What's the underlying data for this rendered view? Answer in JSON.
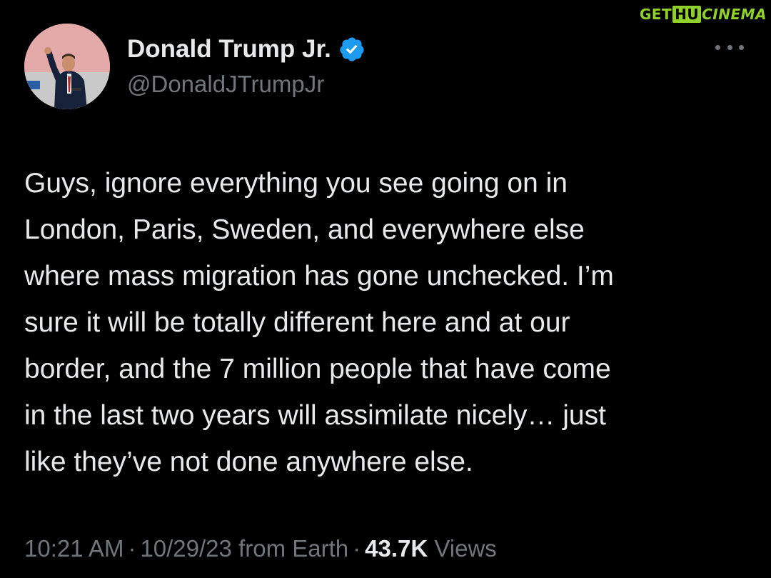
{
  "watermark": {
    "get": "GET",
    "hu": "HU",
    "cinema": "CINEMA"
  },
  "user": {
    "display_name": "Donald Trump Jr.",
    "handle": "@DonaldJTrumpJr",
    "verified": true,
    "verified_icon": "verified-badge-icon",
    "avatar_icon": "profile-photo"
  },
  "tweet": {
    "text": "Guys, ignore everything you see going on in\nLondon, Paris, Sweden, and everywhere else\nwhere mass migration has gone unchecked. I’m\nsure it will be totally different here and at our\nborder, and the 7 million people that have come\nin the last two years will assimilate nicely… just\nlike they’ve not done anywhere else.",
    "time": "10:21 AM",
    "date": "10/29/23 from Earth",
    "separator": "·",
    "views_count": "43.7K",
    "views_label": "Views"
  },
  "more_menu_icon": "more-horizontal-icon",
  "colors": {
    "background": "#000000",
    "primary_text": "#e7e9ea",
    "secondary_text": "#71767b",
    "verified_blue": "#1d9bf0",
    "watermark_green": "#8fd12a"
  }
}
